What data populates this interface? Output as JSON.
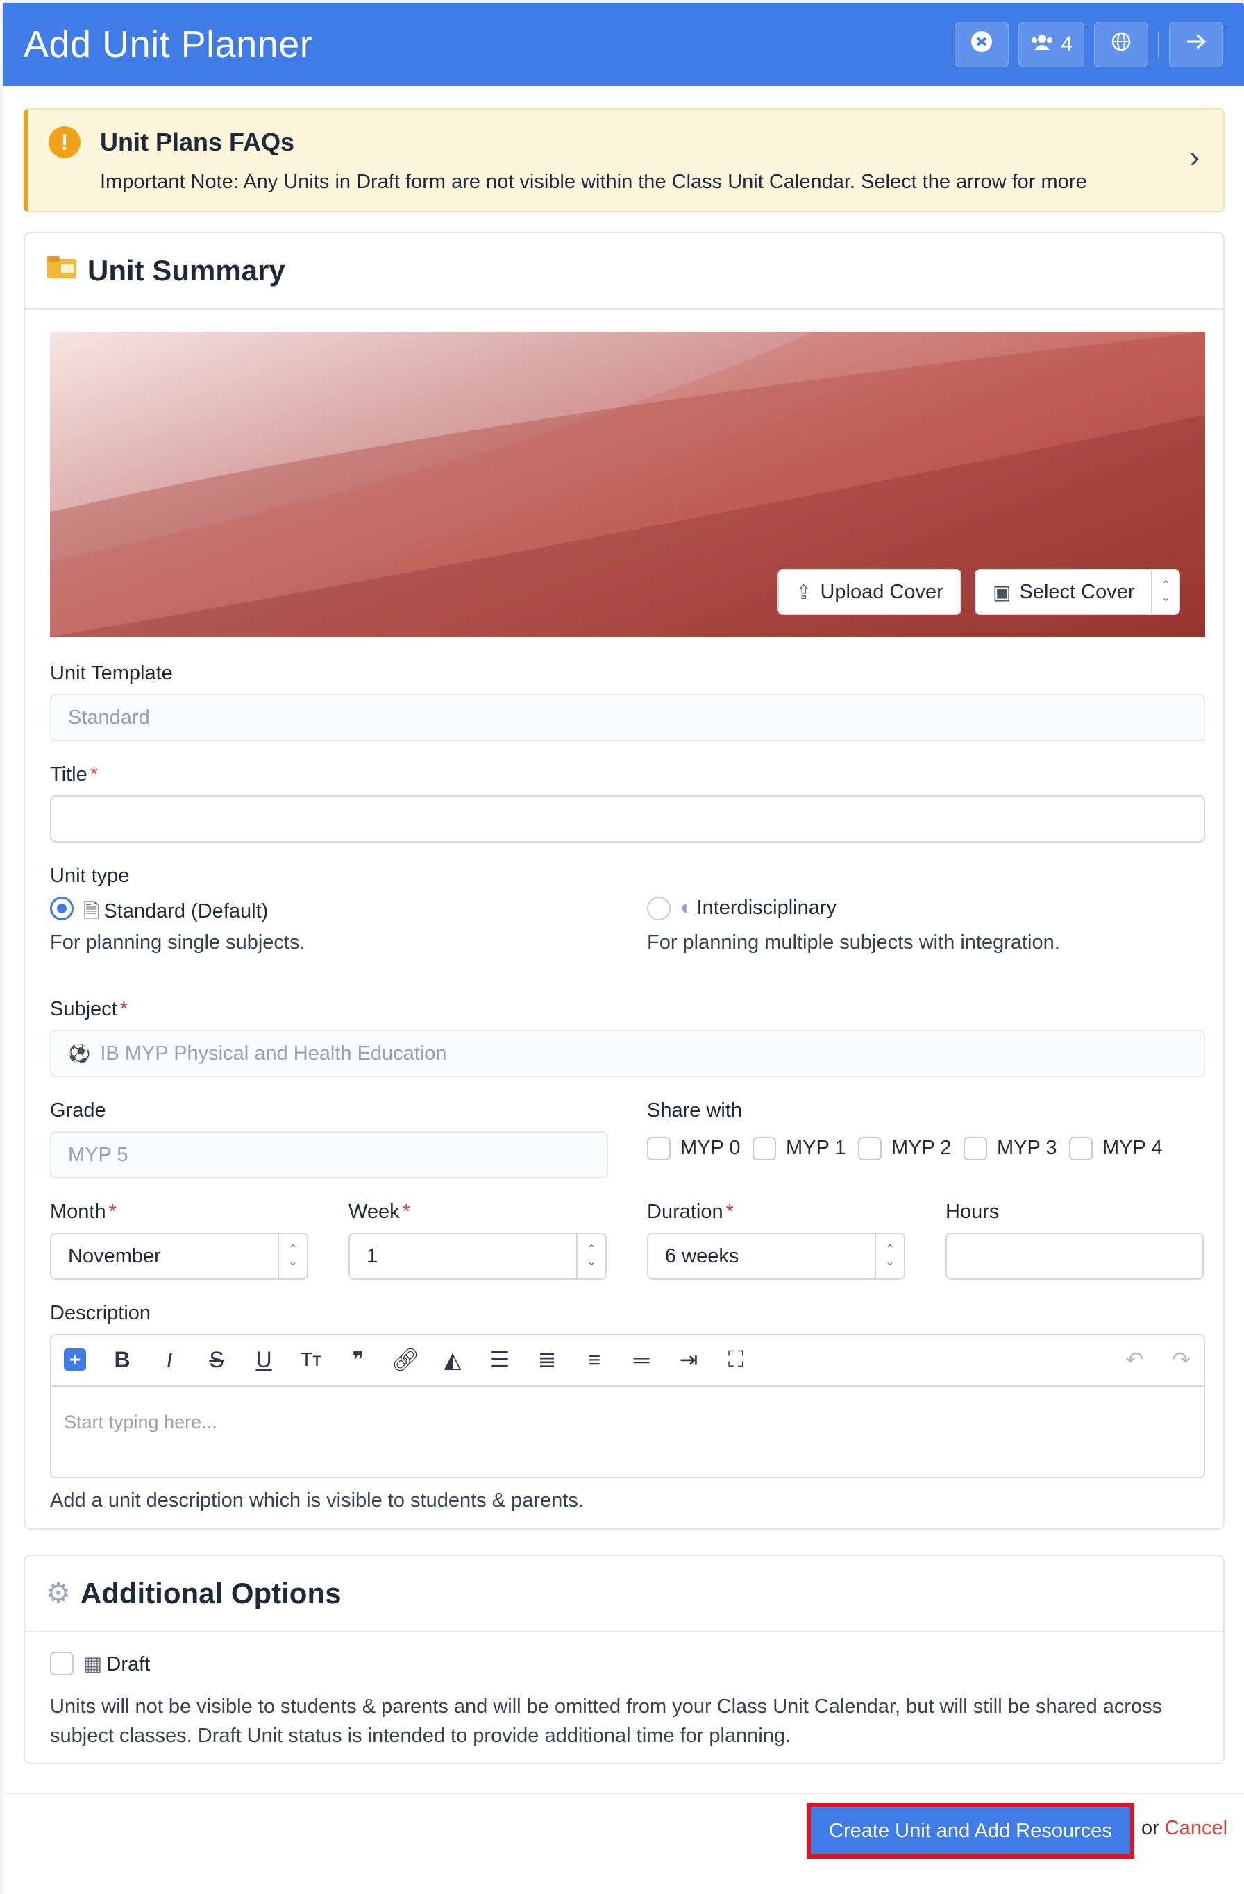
{
  "header": {
    "title": "Add Unit Planner",
    "members_count": "4",
    "icons": [
      "chat-icon",
      "users-icon",
      "globe-icon",
      "arrow-right-icon"
    ]
  },
  "faq": {
    "title": "Unit Plans FAQs",
    "note": "Important Note: Any Units in Draft form are not visible within the Class Unit Calendar. Select the arrow for more"
  },
  "summary": {
    "heading": "Unit Summary",
    "upload_cover": "Upload Cover",
    "select_cover": "Select Cover",
    "unit_template_label": "Unit Template",
    "unit_template_value": "Standard",
    "title_label": "Title",
    "title_value": "",
    "unit_type_label": "Unit type",
    "unit_types": [
      {
        "label": "Standard (Default)",
        "help": "For planning single subjects.",
        "selected": true
      },
      {
        "label": "Interdisciplinary",
        "help": "For planning multiple subjects with integration.",
        "selected": false
      }
    ],
    "subject_label": "Subject",
    "subject_value": "IB MYP Physical and Health Education",
    "grade_label": "Grade",
    "grade_value": "MYP 5",
    "share_label": "Share with",
    "share_options": [
      "MYP 0",
      "MYP 1",
      "MYP 2",
      "MYP 3",
      "MYP 4"
    ],
    "month_label": "Month",
    "month_value": "November",
    "week_label": "Week",
    "week_value": "1",
    "duration_label": "Duration",
    "duration_value": "6 weeks",
    "hours_label": "Hours",
    "hours_value": "",
    "description_label": "Description",
    "description_placeholder": "Start typing here...",
    "description_help": "Add a unit description which is visible to students & parents.",
    "required_mark": "*"
  },
  "additional": {
    "heading": "Additional Options",
    "draft_label": "Draft",
    "draft_help": "Units will not be visible to students & parents and will be omitted from your Class Unit Calendar, but will still be shared across subject classes. Draft Unit status is intended to provide additional time for planning."
  },
  "footer": {
    "submit": "Create Unit and Add Resources",
    "or": "or",
    "cancel": "Cancel"
  },
  "colors": {
    "primary": "#3f7ce8",
    "danger": "#d93c3c",
    "warning": "#f0a31a"
  }
}
